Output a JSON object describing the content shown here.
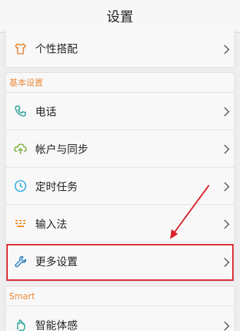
{
  "header": {
    "title": "设置"
  },
  "top_card": {
    "item": {
      "label": "个性搭配",
      "icon": "shirt-icon"
    }
  },
  "basic": {
    "section_title": "基本设置",
    "items": [
      {
        "label": "电话",
        "icon": "phone-icon"
      },
      {
        "label": "帐户与同步",
        "icon": "cloud-sync-icon"
      },
      {
        "label": "定时任务",
        "icon": "clock-icon"
      },
      {
        "label": "输入法",
        "icon": "keyboard-icon"
      },
      {
        "label": "更多设置",
        "icon": "wrench-icon"
      }
    ]
  },
  "smart": {
    "section_title": "Smart",
    "items": [
      {
        "label": "智能体感",
        "icon": "gesture-icon"
      }
    ]
  },
  "colors": {
    "section_text": "#e8893b",
    "highlight": "#d8232a",
    "phone_icon": "#2ba39a",
    "sync_icon": "#7cb342",
    "clock_icon": "#29a9e0",
    "keyboard_icon": "#f28c28",
    "wrench_icon": "#2a7fc1"
  }
}
